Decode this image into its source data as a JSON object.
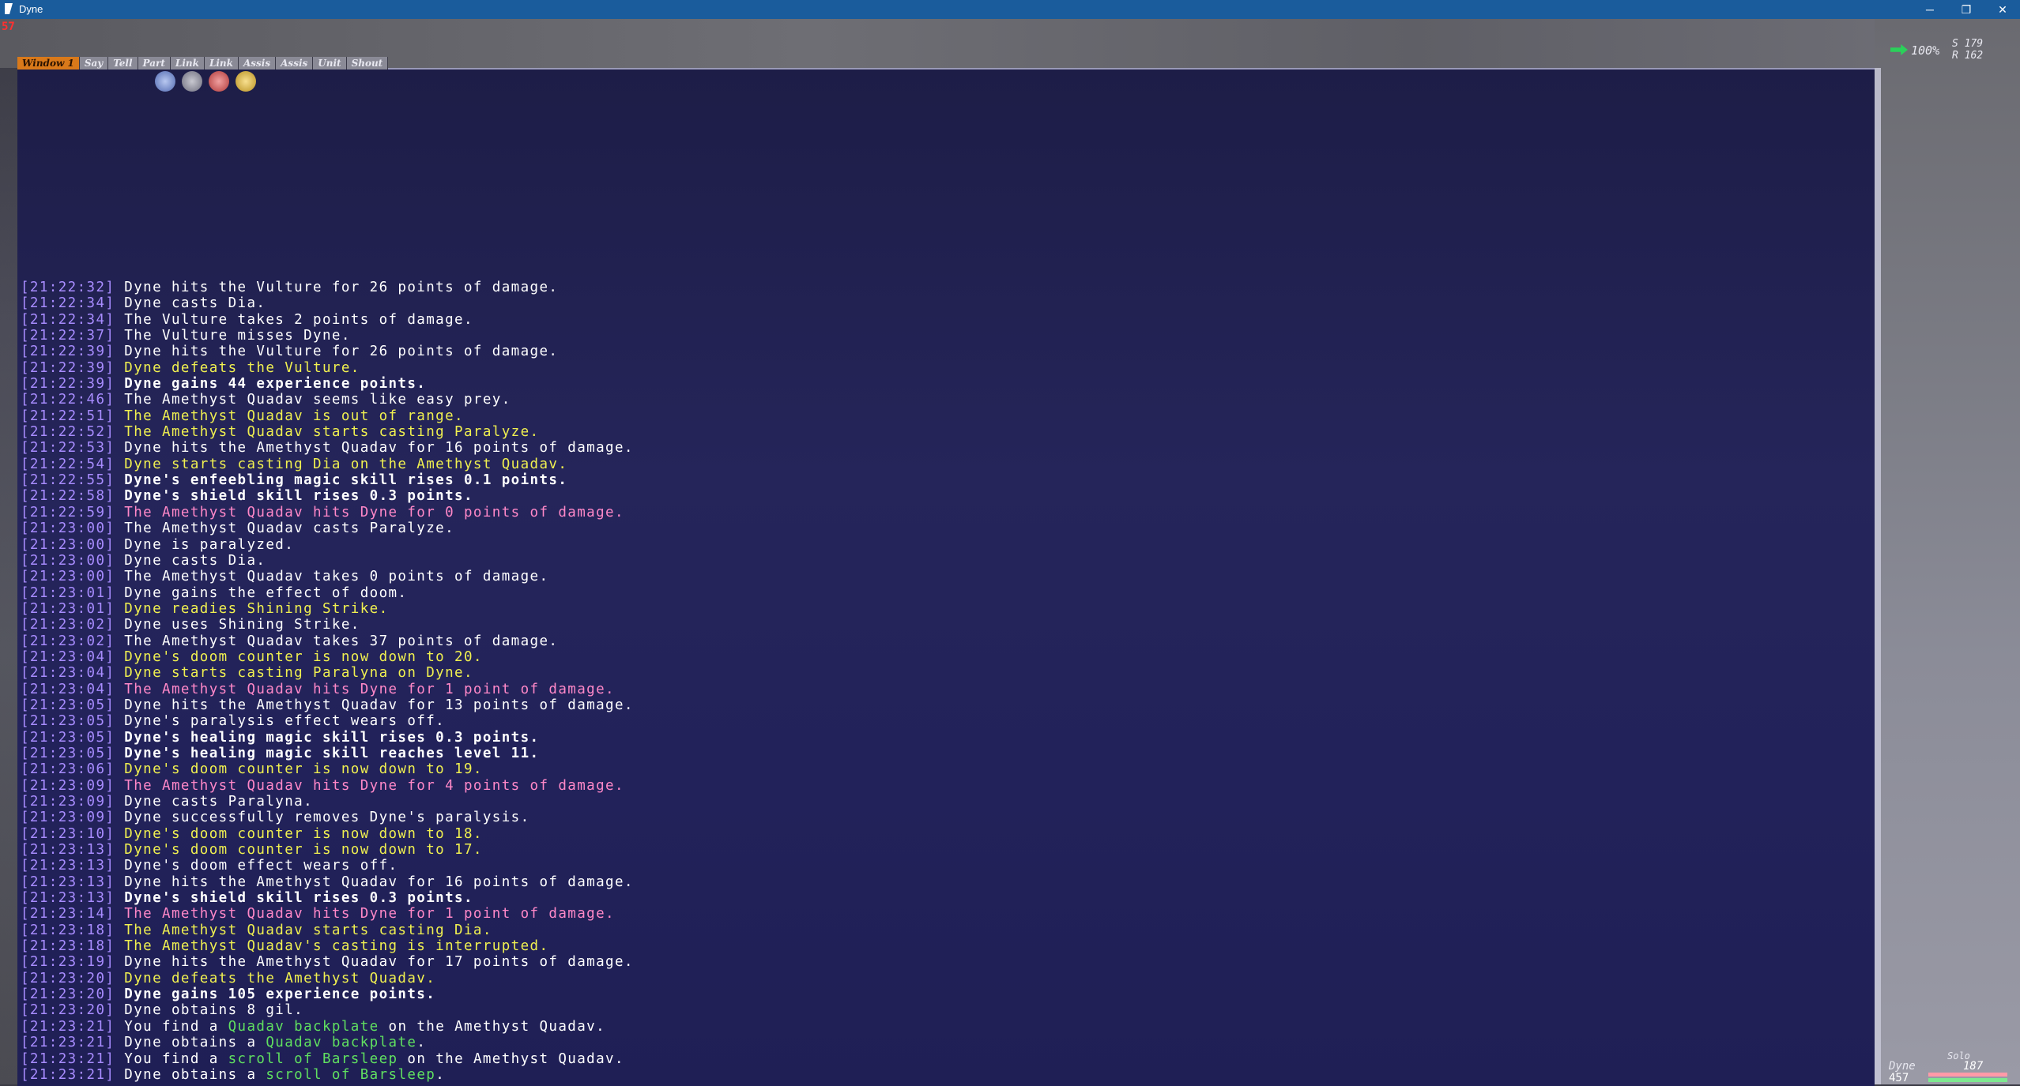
{
  "window": {
    "title": "Dyne",
    "min_glyph": "─",
    "max_glyph": "❐",
    "close_glyph": "✕"
  },
  "hud": {
    "level_indicator": "57",
    "status_percent": "100%",
    "coord_s": "S 179",
    "coord_r": "R 162",
    "party_label": "Solo",
    "party_name": "Dyne",
    "party_hp": "187",
    "party_mp": "457"
  },
  "chat": {
    "tabs": [
      "Window 1",
      "Say",
      "Tell",
      "Part",
      "Link",
      "Link",
      "Assis",
      "Assis",
      "Unit",
      "Shout"
    ],
    "lines": [
      {
        "ts": "21:22:32",
        "parts": [
          {
            "t": "Dyne hits the Vulture for 26 points of damage.",
            "c": "w"
          }
        ]
      },
      {
        "ts": "21:22:34",
        "parts": [
          {
            "t": "Dyne casts Dia.",
            "c": "w"
          }
        ]
      },
      {
        "ts": "21:22:34",
        "parts": [
          {
            "t": "The Vulture takes 2 points of damage.",
            "c": "w"
          }
        ]
      },
      {
        "ts": "21:22:37",
        "parts": [
          {
            "t": "The Vulture misses Dyne.",
            "c": "w"
          }
        ]
      },
      {
        "ts": "21:22:39",
        "parts": [
          {
            "t": "Dyne hits the Vulture for 26 points of damage.",
            "c": "w"
          }
        ]
      },
      {
        "ts": "21:22:39",
        "parts": [
          {
            "t": "Dyne defeats the Vulture.",
            "c": "y"
          }
        ]
      },
      {
        "ts": "21:22:39",
        "parts": [
          {
            "t": "Dyne gains 44 experience points.",
            "c": "wb"
          }
        ]
      },
      {
        "ts": "21:22:46",
        "parts": [
          {
            "t": "The Amethyst Quadav seems like easy prey.",
            "c": "w"
          }
        ]
      },
      {
        "ts": "21:22:51",
        "parts": [
          {
            "t": "The Amethyst Quadav is out of range.",
            "c": "y"
          }
        ]
      },
      {
        "ts": "21:22:52",
        "parts": [
          {
            "t": "The Amethyst Quadav starts casting Paralyze.",
            "c": "y"
          }
        ]
      },
      {
        "ts": "21:22:53",
        "parts": [
          {
            "t": "Dyne hits the Amethyst Quadav for 16 points of damage.",
            "c": "w"
          }
        ]
      },
      {
        "ts": "21:22:54",
        "parts": [
          {
            "t": "Dyne starts casting Dia on the Amethyst Quadav.",
            "c": "y"
          }
        ]
      },
      {
        "ts": "21:22:55",
        "parts": [
          {
            "t": "Dyne's enfeebling magic skill rises 0.1 points.",
            "c": "wb"
          }
        ]
      },
      {
        "ts": "21:22:58",
        "parts": [
          {
            "t": "Dyne's shield skill rises 0.3 points.",
            "c": "wb"
          }
        ]
      },
      {
        "ts": "21:22:59",
        "parts": [
          {
            "t": "The Amethyst Quadav hits Dyne for 0 points of damage.",
            "c": "p"
          }
        ]
      },
      {
        "ts": "21:23:00",
        "parts": [
          {
            "t": "The Amethyst Quadav casts Paralyze.",
            "c": "w"
          }
        ]
      },
      {
        "ts": "21:23:00",
        "parts": [
          {
            "t": "Dyne is paralyzed.",
            "c": "w"
          }
        ]
      },
      {
        "ts": "21:23:00",
        "parts": [
          {
            "t": "Dyne casts Dia.",
            "c": "w"
          }
        ]
      },
      {
        "ts": "21:23:00",
        "parts": [
          {
            "t": "The Amethyst Quadav takes 0 points of damage.",
            "c": "w"
          }
        ]
      },
      {
        "ts": "21:23:01",
        "parts": [
          {
            "t": "Dyne gains the effect of doom.",
            "c": "w"
          }
        ]
      },
      {
        "ts": "21:23:01",
        "parts": [
          {
            "t": "Dyne readies Shining Strike.",
            "c": "y"
          }
        ]
      },
      {
        "ts": "21:23:02",
        "parts": [
          {
            "t": "Dyne uses Shining Strike.",
            "c": "w"
          }
        ]
      },
      {
        "ts": "21:23:02",
        "parts": [
          {
            "t": "The Amethyst Quadav takes 37 points of damage.",
            "c": "w"
          }
        ]
      },
      {
        "ts": "21:23:04",
        "parts": [
          {
            "t": "Dyne's doom counter is now down to 20.",
            "c": "y"
          }
        ]
      },
      {
        "ts": "21:23:04",
        "parts": [
          {
            "t": "Dyne starts casting Paralyna on Dyne.",
            "c": "y"
          }
        ]
      },
      {
        "ts": "21:23:04",
        "parts": [
          {
            "t": "The Amethyst Quadav hits Dyne for 1 point of damage.",
            "c": "p"
          }
        ]
      },
      {
        "ts": "21:23:05",
        "parts": [
          {
            "t": "Dyne hits the Amethyst Quadav for 13 points of damage.",
            "c": "w"
          }
        ]
      },
      {
        "ts": "21:23:05",
        "parts": [
          {
            "t": "Dyne's paralysis effect wears off.",
            "c": "w"
          }
        ]
      },
      {
        "ts": "21:23:05",
        "parts": [
          {
            "t": "Dyne's healing magic skill rises 0.3 points.",
            "c": "wb"
          }
        ]
      },
      {
        "ts": "21:23:05",
        "parts": [
          {
            "t": "Dyne's healing magic skill reaches level 11.",
            "c": "wb"
          }
        ]
      },
      {
        "ts": "21:23:06",
        "parts": [
          {
            "t": "Dyne's doom counter is now down to 19.",
            "c": "y"
          }
        ]
      },
      {
        "ts": "21:23:09",
        "parts": [
          {
            "t": "The Amethyst Quadav hits Dyne for 4 points of damage.",
            "c": "p"
          }
        ]
      },
      {
        "ts": "21:23:09",
        "parts": [
          {
            "t": "Dyne casts Paralyna.",
            "c": "w"
          }
        ]
      },
      {
        "ts": "21:23:09",
        "parts": [
          {
            "t": "Dyne successfully removes Dyne's paralysis.",
            "c": "w"
          }
        ]
      },
      {
        "ts": "21:23:10",
        "parts": [
          {
            "t": "Dyne's doom counter is now down to 18.",
            "c": "y"
          }
        ]
      },
      {
        "ts": "21:23:13",
        "parts": [
          {
            "t": "Dyne's doom counter is now down to 17.",
            "c": "y"
          }
        ]
      },
      {
        "ts": "21:23:13",
        "parts": [
          {
            "t": "Dyne's doom effect wears off.",
            "c": "w"
          }
        ]
      },
      {
        "ts": "21:23:13",
        "parts": [
          {
            "t": "Dyne hits the Amethyst Quadav for 16 points of damage.",
            "c": "w"
          }
        ]
      },
      {
        "ts": "21:23:13",
        "parts": [
          {
            "t": "Dyne's shield skill rises 0.3 points.",
            "c": "wb"
          }
        ]
      },
      {
        "ts": "21:23:14",
        "parts": [
          {
            "t": "The Amethyst Quadav hits Dyne for 1 point of damage.",
            "c": "p"
          }
        ]
      },
      {
        "ts": "21:23:18",
        "parts": [
          {
            "t": "The Amethyst Quadav starts casting Dia.",
            "c": "y"
          }
        ]
      },
      {
        "ts": "21:23:18",
        "parts": [
          {
            "t": "The Amethyst Quadav's casting is interrupted.",
            "c": "y"
          }
        ]
      },
      {
        "ts": "21:23:19",
        "parts": [
          {
            "t": "Dyne hits the Amethyst Quadav for 17 points of damage.",
            "c": "w"
          }
        ]
      },
      {
        "ts": "21:23:20",
        "parts": [
          {
            "t": "Dyne defeats the Amethyst Quadav.",
            "c": "y"
          }
        ]
      },
      {
        "ts": "21:23:20",
        "parts": [
          {
            "t": "Dyne gains 105 experience points.",
            "c": "wb"
          }
        ]
      },
      {
        "ts": "21:23:20",
        "parts": [
          {
            "t": "Dyne obtains 8 gil.",
            "c": "w"
          }
        ]
      },
      {
        "ts": "21:23:21",
        "parts": [
          {
            "t": "You find a ",
            "c": "w"
          },
          {
            "t": "Quadav backplate",
            "c": "g"
          },
          {
            "t": " on the Amethyst Quadav.",
            "c": "w"
          }
        ]
      },
      {
        "ts": "21:23:21",
        "parts": [
          {
            "t": "Dyne obtains a ",
            "c": "w"
          },
          {
            "t": "Quadav backplate",
            "c": "g"
          },
          {
            "t": ".",
            "c": "w"
          }
        ]
      },
      {
        "ts": "21:23:21",
        "parts": [
          {
            "t": "You find a ",
            "c": "w"
          },
          {
            "t": "scroll of Barsleep",
            "c": "g"
          },
          {
            "t": " on the Amethyst Quadav.",
            "c": "w"
          }
        ]
      },
      {
        "ts": "21:23:21",
        "parts": [
          {
            "t": "Dyne obtains a ",
            "c": "w"
          },
          {
            "t": "scroll of Barsleep",
            "c": "g"
          },
          {
            "t": ".",
            "c": "w"
          }
        ]
      }
    ]
  },
  "colors": {
    "timestamp": "#a88cff",
    "white": "#ffffff",
    "yellow": "#f0f050",
    "pink": "#ff88c8",
    "green": "#60e060",
    "chat_bg": "#22225a",
    "titlebar": "#1a5c9c"
  }
}
